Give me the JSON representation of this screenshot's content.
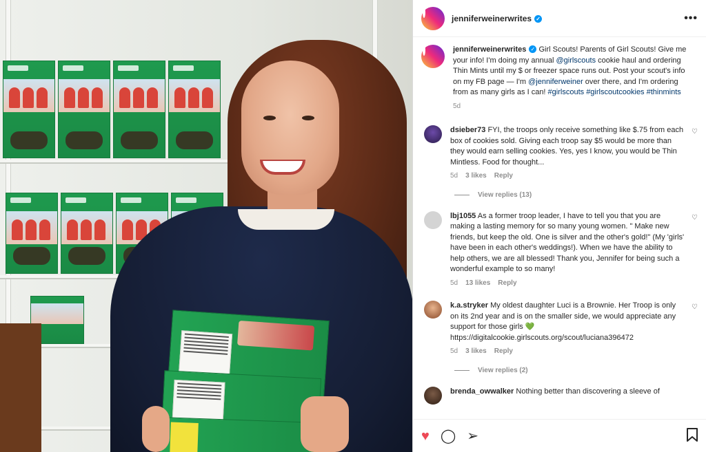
{
  "post": {
    "author": "jenniferweinerwrites",
    "verified_glyph": "✓",
    "more_glyph": "•••",
    "caption": {
      "text_1": "Girl Scouts! Parents of Girl Scouts! Give me your info! I'm doing my annual ",
      "mention_1": "@girlscouts",
      "text_2": " cookie haul and ordering Thin Mints until my $ or freezer space runs out. Post your scout's info on my FB page — I'm ",
      "mention_2": "@jenniferweiner",
      "text_3": " over there, and I'm ordering from as many girls as I can! ",
      "hashtag_1": "#girlscouts",
      "hashtag_2": "#girlscoutcookies",
      "hashtag_3": "#thinmints",
      "age": "5d"
    }
  },
  "comments": [
    {
      "user": "dsieber73",
      "text": "FYI, the troops only receive something like $.75 from each box of cookies sold. Giving each troop say $5 would be more than they would earn selling cookies. Yes, yes I know, you would be Thin Mintless. Food for thought...",
      "age": "5d",
      "likes": "3 likes",
      "reply": "Reply",
      "view_replies": "View replies (13)"
    },
    {
      "user": "lbj1055",
      "text": "As a former troop leader, I have to tell you that you are making a lasting memory for so many young women. \" Make new friends, but keep the old. One is silver and the other's gold!\" (My 'girls' have been in each other's weddings!). When we have the ability to help others, we are all blessed! Thank you, Jennifer for being such a wonderful example to so many!",
      "age": "5d",
      "likes": "13 likes",
      "reply": "Reply"
    },
    {
      "user": "k.a.stryker",
      "text": "My oldest daughter Luci is a Brownie. Her Troop is only on its 2nd year and is on the smaller side, we would appreciate any support for those girls",
      "emoji": "💚",
      "url": "https://digitalcookie.girlscouts.org/scout/luciana396472",
      "age": "5d",
      "likes": "3 likes",
      "reply": "Reply",
      "view_replies": "View replies (2)"
    },
    {
      "user": "brenda_owwalker",
      "text": "Nothing better than discovering a sleeve of"
    }
  ],
  "actions": {
    "like_glyph": "♥",
    "comment_glyph": "◯",
    "share_glyph": "➢",
    "save_glyph": "🔖"
  },
  "colors": {
    "like_red": "#ed4956",
    "verified_blue": "#0095f6",
    "link_blue": "#00376b",
    "meta_gray": "#8e8e8e"
  }
}
